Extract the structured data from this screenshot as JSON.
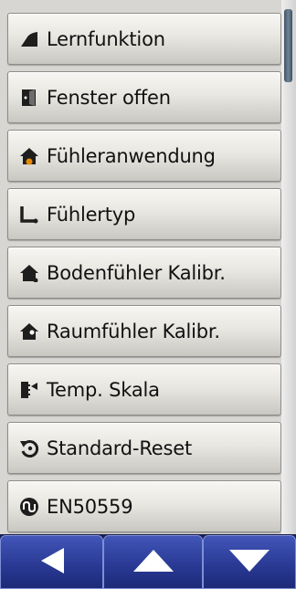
{
  "menu": {
    "items": [
      {
        "label": "Lernfunktion",
        "icon": "learn-function-icon"
      },
      {
        "label": "Fenster offen",
        "icon": "open-window-icon"
      },
      {
        "label": "Fühleranwendung",
        "icon": "sensor-application-icon"
      },
      {
        "label": "Fühlertyp",
        "icon": "sensor-type-icon"
      },
      {
        "label": "Bodenfühler Kalibr.",
        "icon": "floor-sensor-calibration-icon"
      },
      {
        "label": "Raumfühler Kalibr.",
        "icon": "room-sensor-calibration-icon"
      },
      {
        "label": "Temp. Skala",
        "icon": "temperature-scale-icon"
      },
      {
        "label": "Standard-Reset",
        "icon": "reset-icon"
      },
      {
        "label": "EN50559",
        "icon": "en50559-icon"
      }
    ]
  },
  "nav": {
    "back": "back-icon",
    "up": "arrow-up-icon",
    "down": "arrow-down-icon"
  },
  "colors": {
    "nav_blue": "#2a3a95",
    "icon_dark": "#1e1e1e",
    "icon_dot": "#e58a00"
  }
}
